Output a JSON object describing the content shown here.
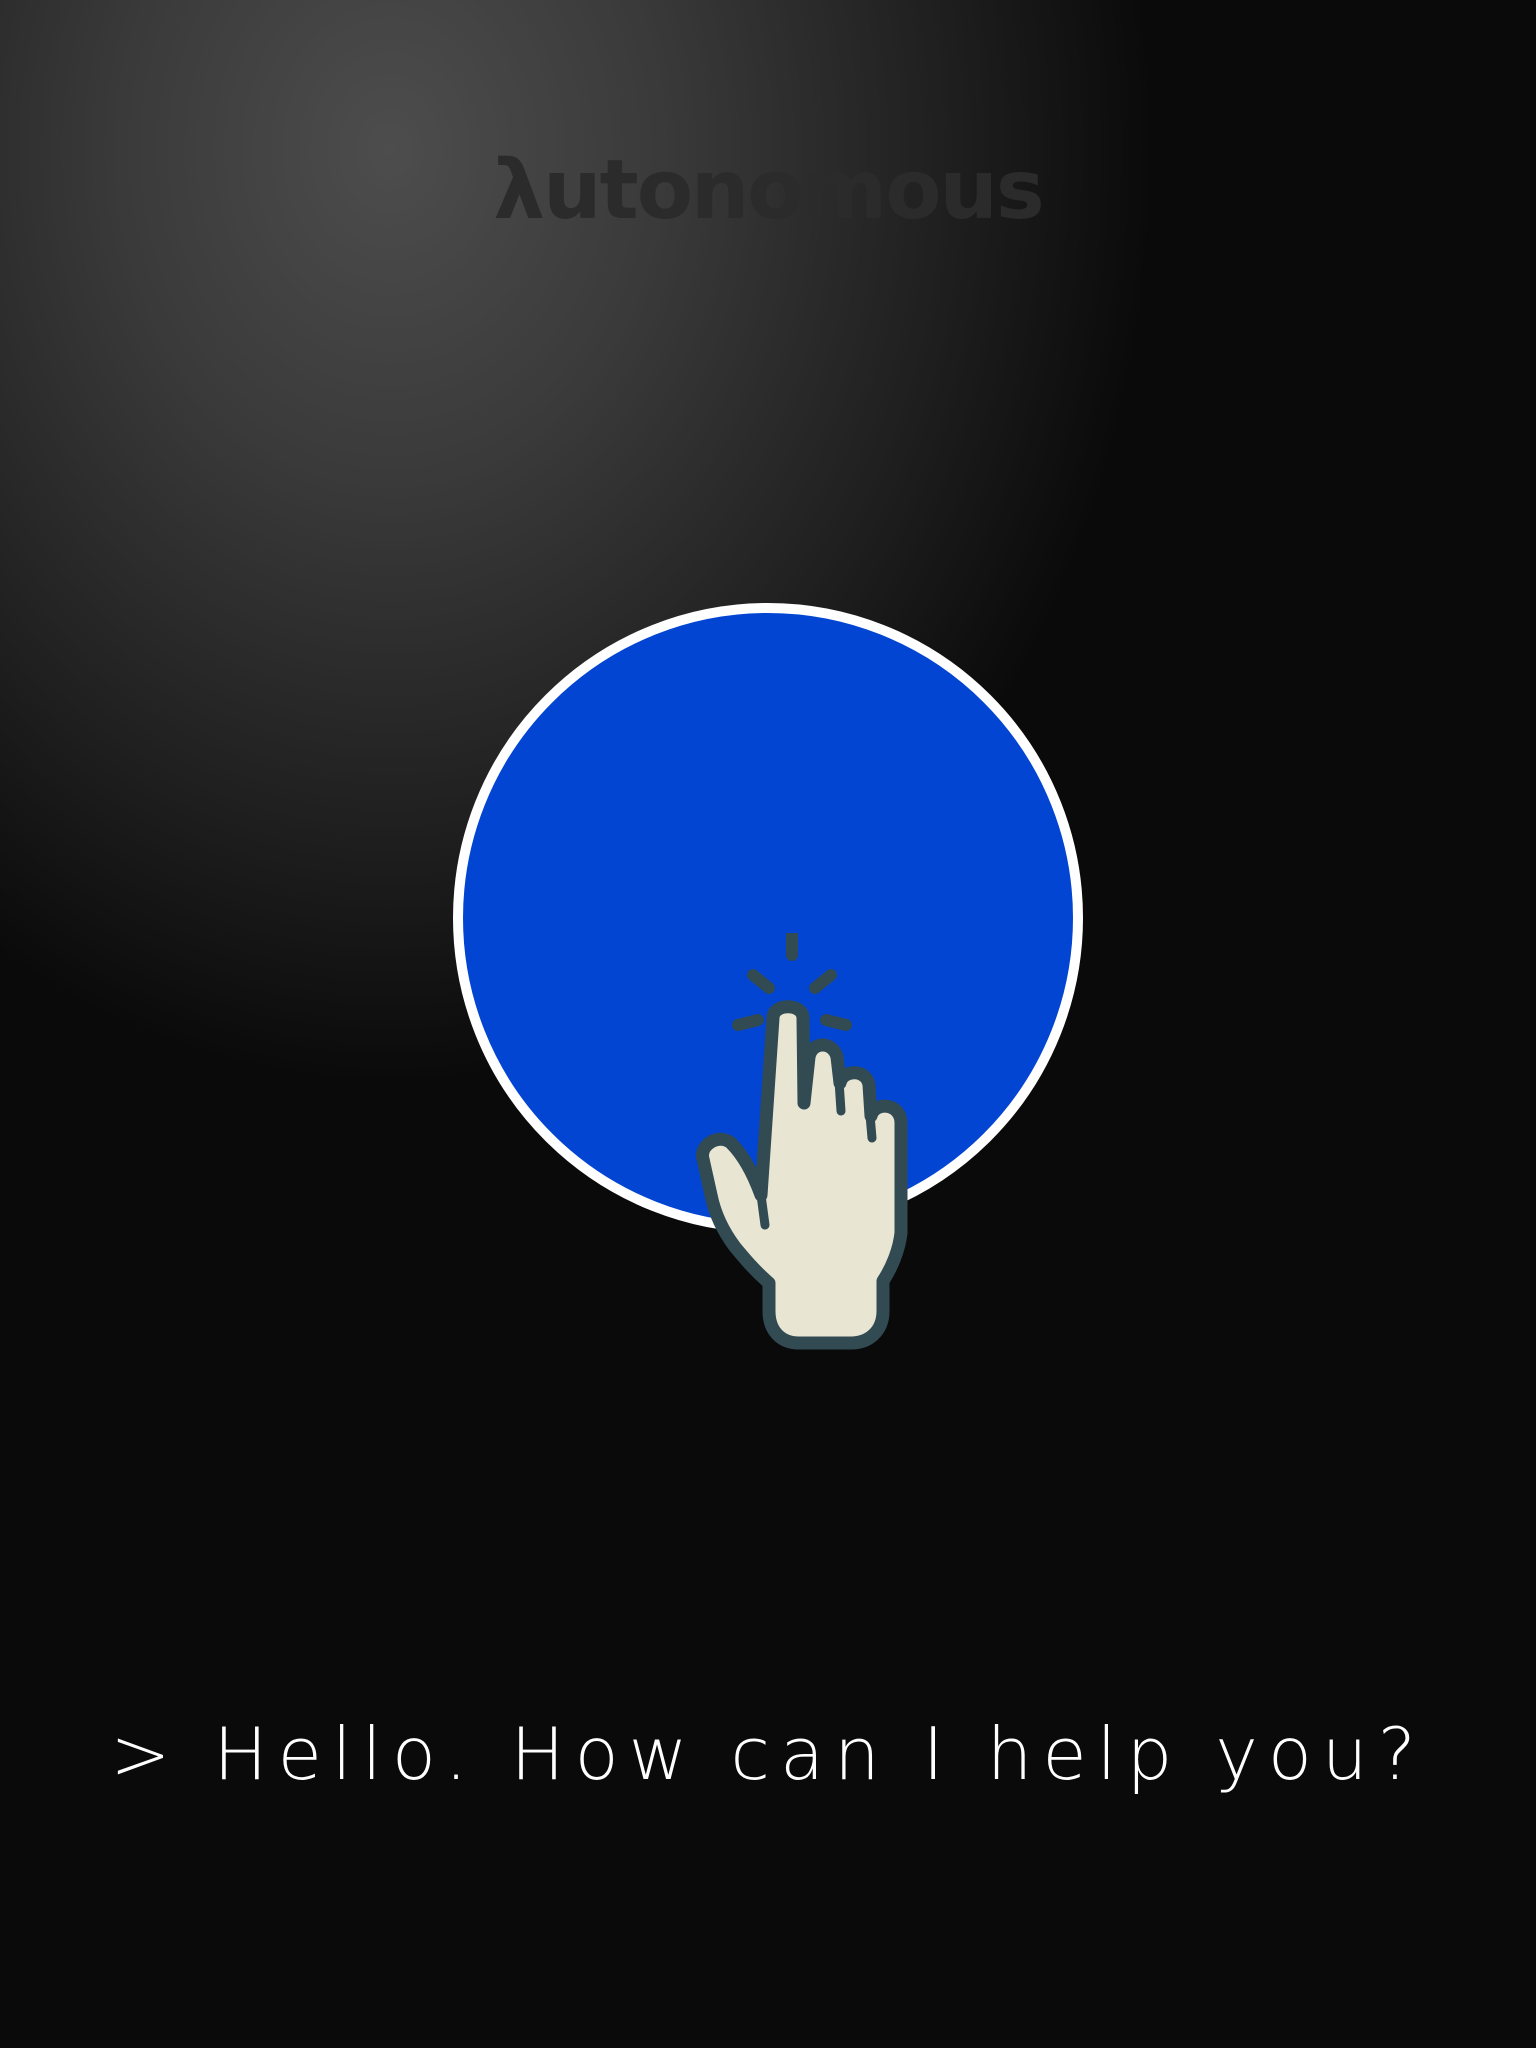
{
  "brand": {
    "logo_text": "λutonomous"
  },
  "assistant": {
    "button_icon": "tap-pointer-icon",
    "greeting": "> Hello. How can I help you?"
  },
  "colors": {
    "orb_fill": "#0345d3",
    "orb_border": "#ffffff",
    "hand_fill": "#e8e6d3",
    "hand_outline": "#324a52",
    "text": "#ffffff",
    "logo": "#2b2b2b"
  }
}
